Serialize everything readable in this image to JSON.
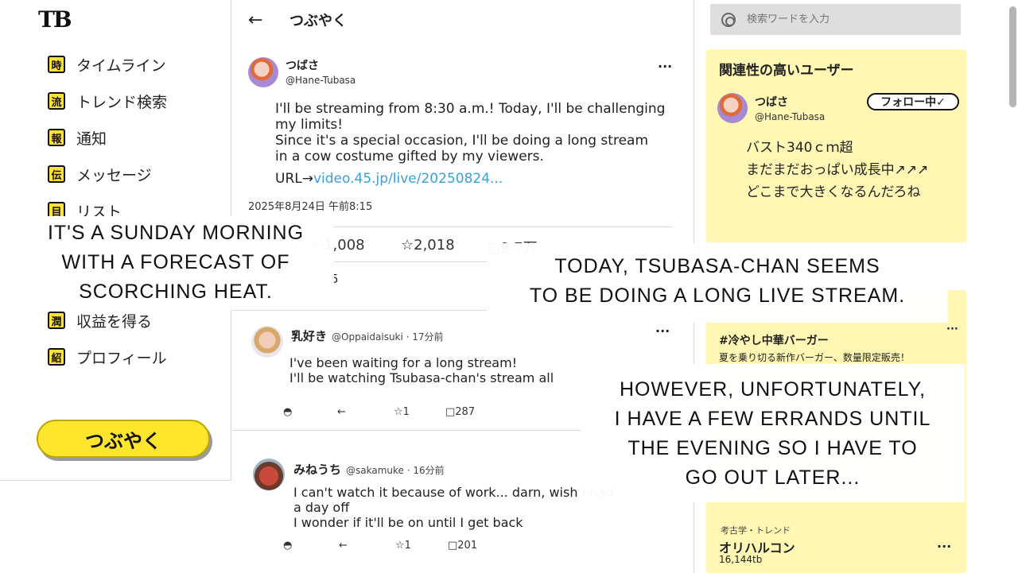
{
  "sidebar": {
    "logo": "TB",
    "items": [
      {
        "icon": "時",
        "icon_name": "timeline-icon",
        "label": "タイムライン"
      },
      {
        "icon": "流",
        "icon_name": "trend-icon",
        "label": "トレンド検索"
      },
      {
        "icon": "報",
        "icon_name": "bell-icon",
        "label": "通知"
      },
      {
        "icon": "伝",
        "icon_name": "message-icon",
        "label": "メッセージ"
      },
      {
        "icon": "目",
        "icon_name": "list-icon",
        "label": "リスト"
      },
      {
        "icon": "潤",
        "icon_name": "money-icon",
        "label": "収益を得る"
      },
      {
        "icon": "紹",
        "icon_name": "profile-icon",
        "label": "プロフィール"
      }
    ],
    "post_button": "つぶやく"
  },
  "main": {
    "title": "つぶやく",
    "post": {
      "name": "つばさ",
      "handle": "@Hane-Tubasa",
      "lines": [
        "I'll be streaming from 8:30 a.m.! Today, I'll be challenging",
        "my limits!",
        "Since it's a special occasion, I'll be doing a long stream",
        "in a cow costume gifted by my viewers."
      ],
      "url_prefix": "URL→",
      "url": "video.45.jp/live/20250824...",
      "date": "2025年8月24日 午前8:15",
      "stat_reposts": "←1,008",
      "stat_likes": "☆2,018",
      "stat_views": "□9.7万",
      "stat_partial": "5"
    },
    "replies": [
      {
        "name": "乳好き",
        "meta": "@Oppaidaisuki · 17分前",
        "lines": [
          "I've been waiting for a long stream!",
          "I'll be watching Tsubasa-chan's stream all"
        ],
        "reply": "◓",
        "repost": "←",
        "like": "☆1",
        "views": "□287"
      },
      {
        "name": "みねうち",
        "meta": "@sakamuke · 16分前",
        "lines": [
          "I can't watch it because of work... darn, wish I had",
          "a day off",
          "I wonder if it'll be on until I get back"
        ],
        "reply": "◓",
        "repost": "←",
        "like": "☆1",
        "views": "□201"
      }
    ]
  },
  "right": {
    "search_placeholder": "検索ワードを入力",
    "users_title": "関連性の高いユーザー",
    "user": {
      "name": "つばさ",
      "handle": "@Hane-Tubasa",
      "follow": "フォロー中✓",
      "bio": [
        "バスト340ｃｍ超",
        "まだまだおっぱい成長中↗↗↗",
        "どこまで大きくなるんだろね"
      ]
    },
    "trend1": {
      "tag": "#冷やし中華バーガー",
      "desc": "夏を乗り切る新作バーガー、数量限定販売！"
    },
    "trend2": {
      "category": "考古学・トレンド",
      "name": "オリハルコン",
      "count": "16,144tb"
    }
  },
  "captions": {
    "c1": [
      "It's a Sunday morning",
      "with a forecast of",
      "scorching heat."
    ],
    "c2": [
      "Today, Tsubasa-chan seems",
      "to be doing a long live stream."
    ],
    "c3": [
      "However, unfortunately,",
      "I have a few errands until",
      "the evening so I have to",
      "go out later..."
    ]
  },
  "colors": {
    "accent_yellow": "#ffe62d",
    "panel_yellow": "#fff7b3",
    "link": "#3aa0d8"
  }
}
